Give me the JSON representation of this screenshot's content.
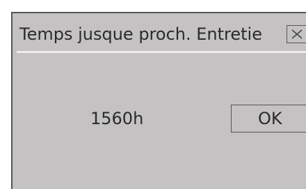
{
  "dialog": {
    "title": "Temps jusque proch. Entretie",
    "close_icon": "close-icon",
    "value": "1560h",
    "ok_label": "OK"
  },
  "colors": {
    "background": "#c4c2c3",
    "border": "#555555",
    "divider": "#eeeeee",
    "text": "#2b2b2b"
  }
}
